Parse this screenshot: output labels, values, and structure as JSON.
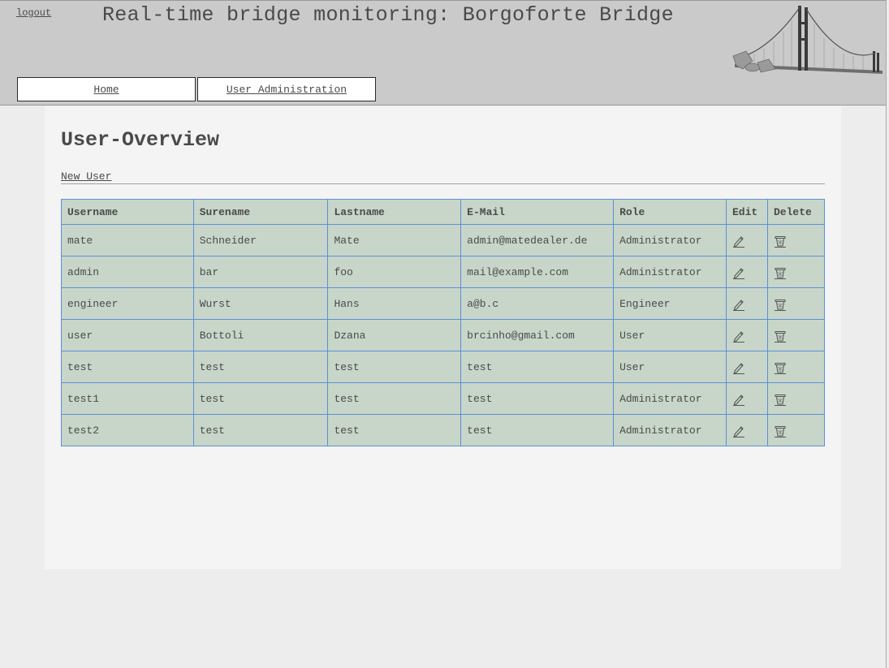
{
  "header": {
    "logout_label": "logout",
    "title": "Real-time bridge monitoring: Borgoforte Bridge",
    "logo_icon": "bridge-logo"
  },
  "nav": {
    "tabs": [
      {
        "label": "Home"
      },
      {
        "label": "User Administration"
      }
    ]
  },
  "main": {
    "title": "User-Overview",
    "new_user_label": "New User",
    "table": {
      "columns": [
        "Username",
        "Surename",
        "Lastname",
        "E-Mail",
        "Role",
        "Edit",
        "Delete"
      ],
      "edit_icon": "pencil-icon",
      "delete_icon": "trash-icon",
      "rows": [
        {
          "username": "mate",
          "surename": "Schneider",
          "lastname": "Mate",
          "email": "admin@matedealer.de",
          "role": "Administrator"
        },
        {
          "username": "admin",
          "surename": "bar",
          "lastname": "foo",
          "email": "mail@example.com",
          "role": "Administrator"
        },
        {
          "username": "engineer",
          "surename": "Wurst",
          "lastname": "Hans",
          "email": "a@b.c",
          "role": "Engineer"
        },
        {
          "username": "user",
          "surename": "Bottoli",
          "lastname": "Dzana",
          "email": "brcinho@gmail.com",
          "role": "User"
        },
        {
          "username": "test",
          "surename": "test",
          "lastname": "test",
          "email": "test",
          "role": "User"
        },
        {
          "username": "test1",
          "surename": "test",
          "lastname": "test",
          "email": "test",
          "role": "Administrator"
        },
        {
          "username": "test2",
          "surename": "test",
          "lastname": "test",
          "email": "test",
          "role": "Administrator"
        }
      ]
    }
  },
  "colors": {
    "header_bg": "#cacaca",
    "page_bg": "#ededed",
    "content_bg": "#f4f4f4",
    "table_bg": "#c8d6c9",
    "table_border": "#5b8fd8",
    "text": "#4a4a4a"
  }
}
